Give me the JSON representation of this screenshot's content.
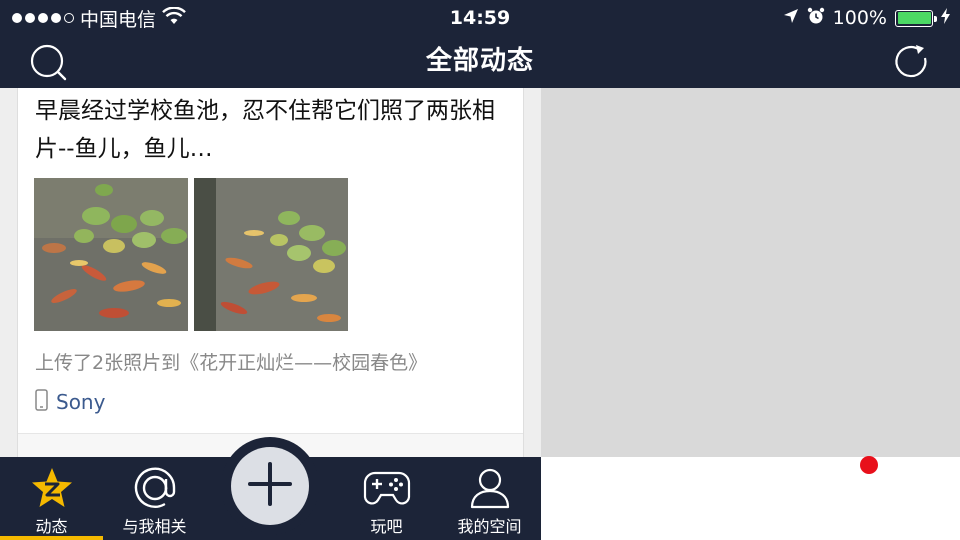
{
  "status_bar": {
    "carrier": "中国电信",
    "time": "14:59",
    "battery": "100%",
    "battery_level": 1.0,
    "signal_bars_filled": 4,
    "signal_bars_total": 5
  },
  "nav": {
    "title": "全部动态",
    "left_icon": "search-icon",
    "right_icon": "refresh-icon"
  },
  "post": {
    "text": "早晨经过学校鱼池，忍不住帮它们照了两张相片--鱼儿，鱼儿…",
    "photos": [
      {
        "name": "fish-pond-photo-1"
      },
      {
        "name": "fish-pond-photo-2"
      }
    ],
    "upload_info": "上传了2张照片到《花开正灿烂——校园春色》",
    "device": "Sony"
  },
  "tabbar": {
    "tabs": [
      {
        "label": "动态",
        "icon": "qzone-star-icon",
        "active": true
      },
      {
        "label": "与我相关",
        "icon": "at-sign-icon"
      },
      {
        "label": "玩吧",
        "icon": "gamepad-icon"
      },
      {
        "label": "我的空间",
        "icon": "person-icon"
      }
    ],
    "center_button_icon": "plus-icon"
  },
  "colors": {
    "bar_background": "#1c2438",
    "active_tab_accent": "#f5b900",
    "notification_dot": "#e8101b",
    "link_text": "#3b5a8e",
    "battery_fill": "#4cd964"
  }
}
